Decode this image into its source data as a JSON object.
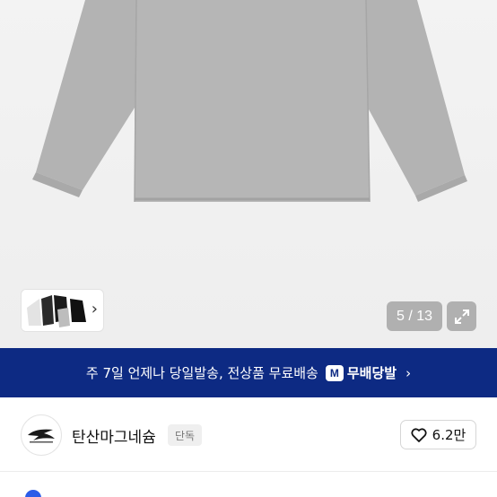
{
  "gallery": {
    "counter": "5 / 13",
    "product_color": "#b4b4b4"
  },
  "banner": {
    "text": "주 7일 언제나 당일발송, 전상품 무료배송",
    "badge_letter": "M",
    "badge_label": "무배당발",
    "background": "#0d2a83"
  },
  "shop": {
    "name": "탄산마그네슘",
    "tag": "단독",
    "likes": "6.2만"
  },
  "info": {
    "text": ""
  }
}
